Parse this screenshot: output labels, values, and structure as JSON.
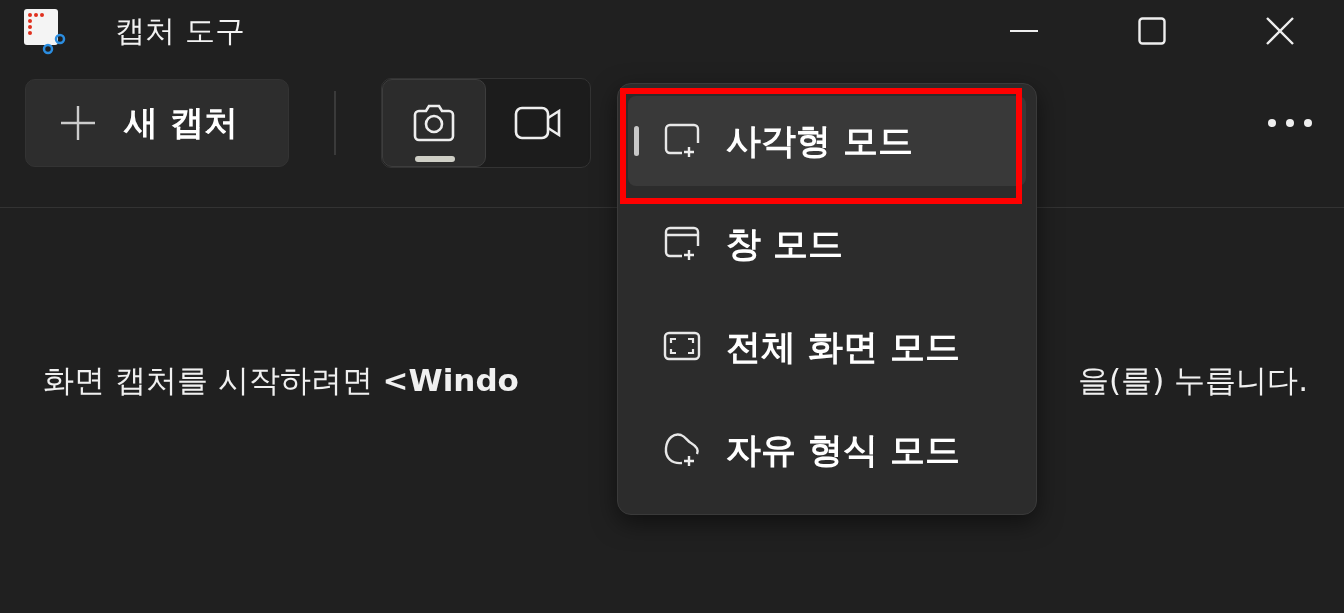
{
  "window": {
    "title": "캡처 도구"
  },
  "toolbar": {
    "new_capture": "새 캡처",
    "modes": [
      {
        "kind": "camera",
        "selected": true
      },
      {
        "kind": "video",
        "selected": false
      }
    ]
  },
  "hint": {
    "left": "화면 캡처를 시작하려면 **<Windo**",
    "right": "을(를) 누릅니다."
  },
  "menu": {
    "items": [
      {
        "kind": "rectangle",
        "label": "사각형 모드",
        "selected": true,
        "highlighted": true
      },
      {
        "kind": "window",
        "label": "창 모드",
        "selected": false,
        "highlighted": false
      },
      {
        "kind": "fullscreen",
        "label": "전체 화면 모드",
        "selected": false,
        "highlighted": false
      },
      {
        "kind": "freeform",
        "label": "자유 형식 모드",
        "selected": false,
        "highlighted": false
      }
    ]
  }
}
